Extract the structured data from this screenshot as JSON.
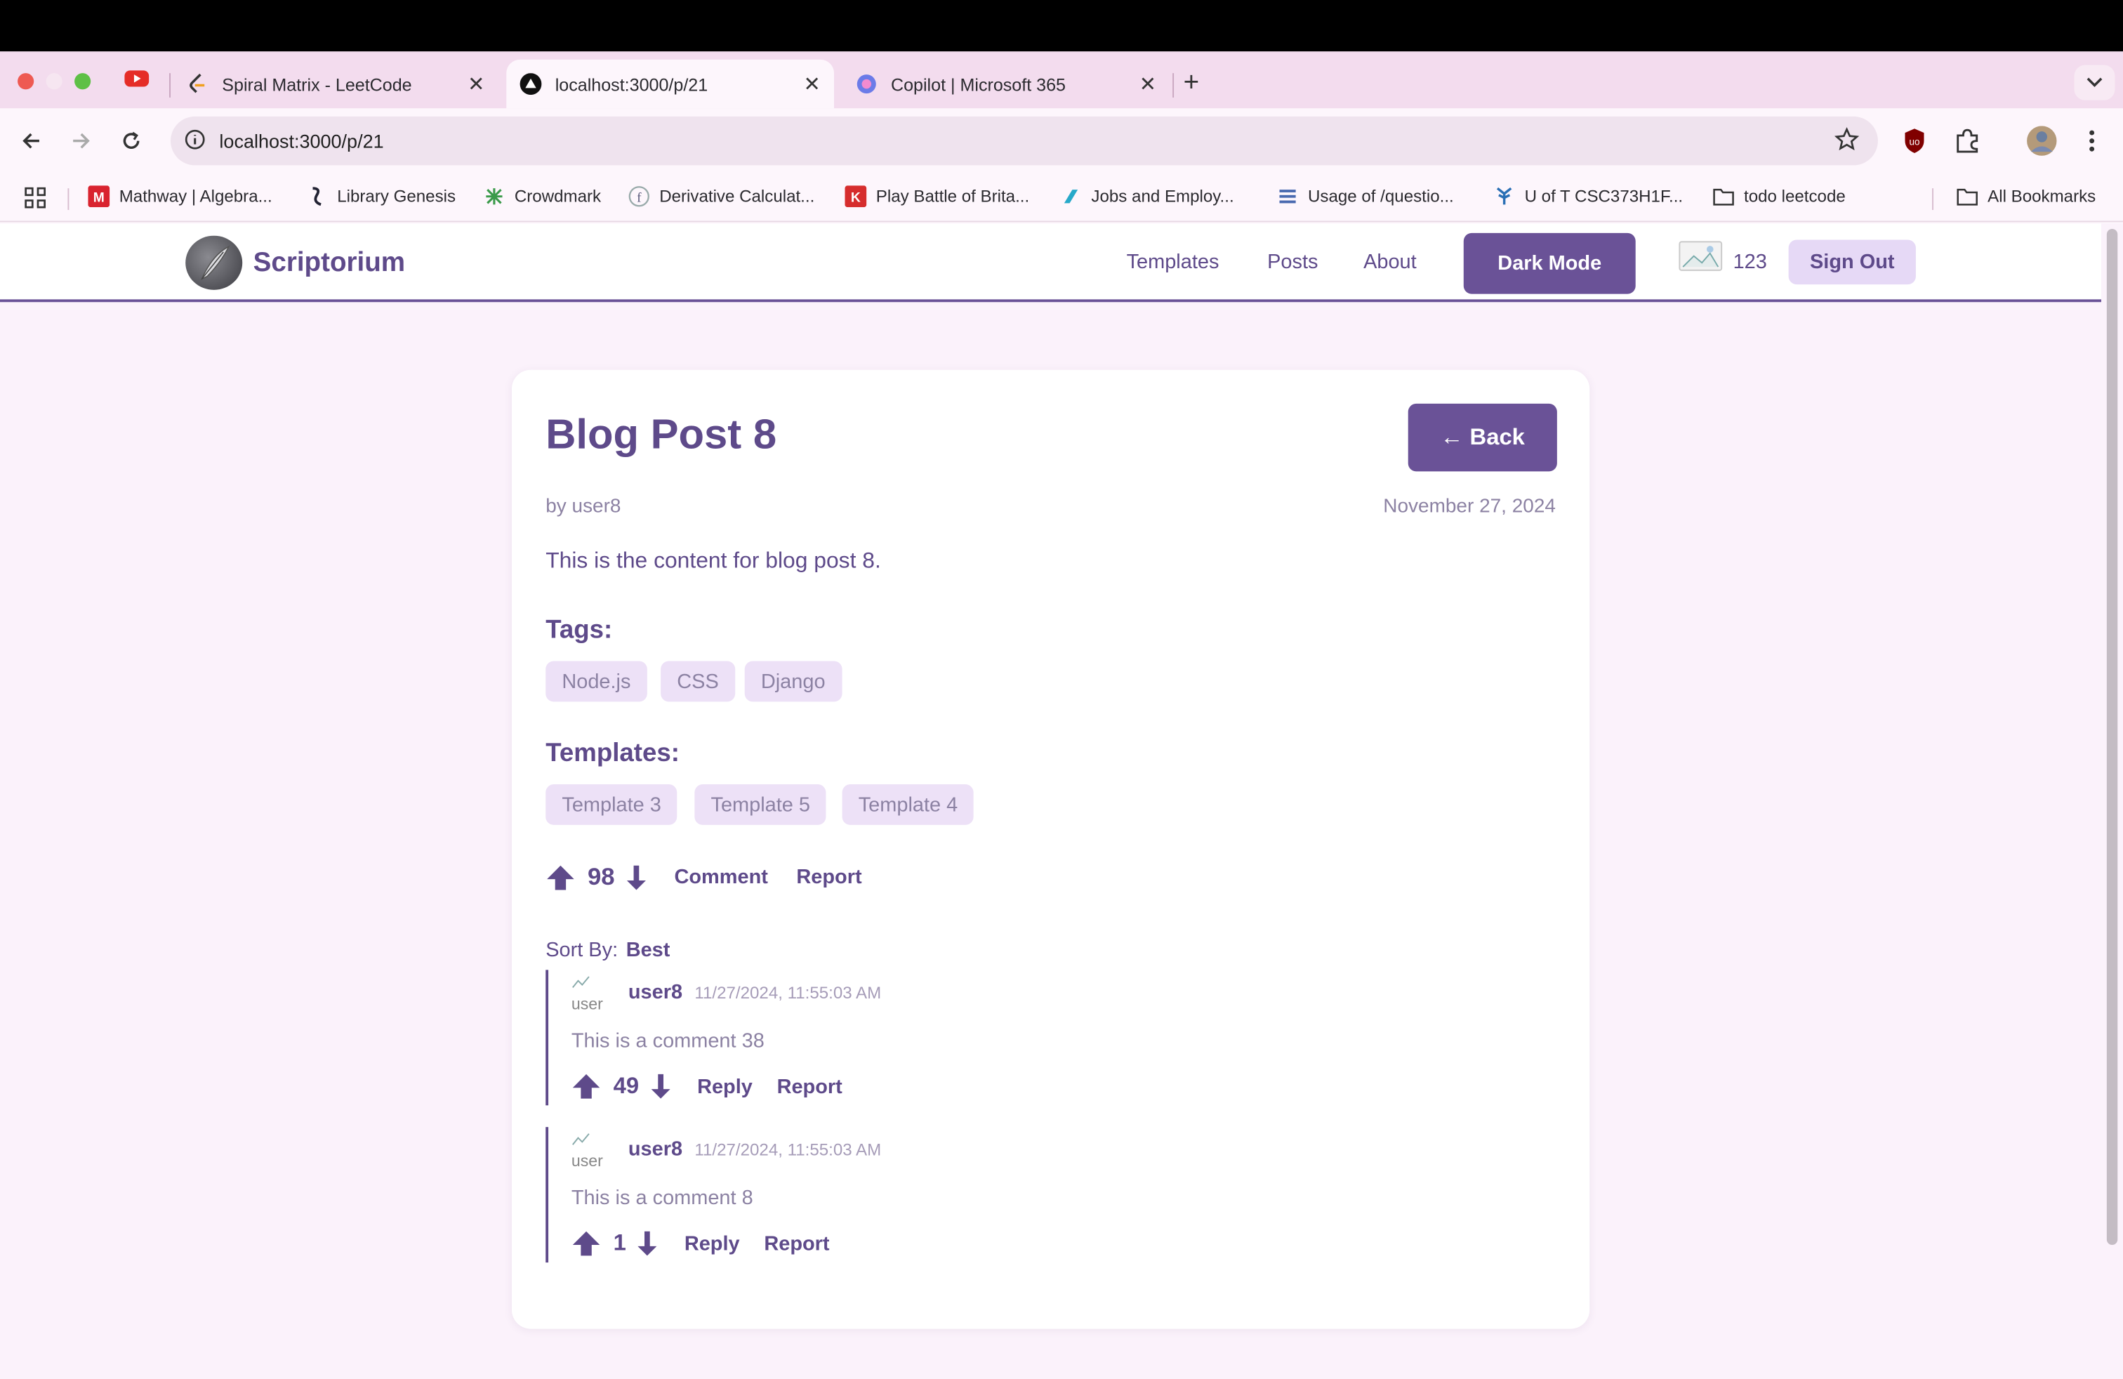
{
  "browser": {
    "tabs": [
      {
        "title": "Spiral Matrix - LeetCode",
        "icon": "leetcode-icon",
        "active": false
      },
      {
        "title": "localhost:3000/p/21",
        "icon": "vercel-triangle-icon",
        "active": true
      },
      {
        "title": "Copilot | Microsoft 365",
        "icon": "copilot-icon",
        "active": false
      }
    ],
    "url": "localhost:3000/p/21",
    "bookmarks": [
      {
        "label": "Mathway | Algebra...",
        "icon": "mathway-icon"
      },
      {
        "label": "Library Genesis",
        "icon": "libgen-icon"
      },
      {
        "label": "Crowdmark",
        "icon": "crowdmark-icon"
      },
      {
        "label": "Derivative Calculat...",
        "icon": "derivative-icon"
      },
      {
        "label": "Play Battle of Brita...",
        "icon": "game-icon"
      },
      {
        "label": "Jobs and Employ...",
        "icon": "jobs-icon"
      },
      {
        "label": "Usage of /questio...",
        "icon": "stack-icon"
      },
      {
        "label": "U of T CSC373H1F...",
        "icon": "uoft-icon"
      },
      {
        "label": "todo leetcode",
        "icon": "folder-icon"
      }
    ],
    "all_bookmarks": "All Bookmarks"
  },
  "site": {
    "brand": "Scriptorium",
    "nav": {
      "templates": "Templates",
      "posts": "Posts",
      "about": "About"
    },
    "dark_mode": "Dark Mode",
    "points": "123",
    "sign_out": "Sign Out"
  },
  "post": {
    "title": "Blog Post 8",
    "back": "← Back",
    "byline": "by user8",
    "date": "November 27, 2024",
    "content": "This is the content for blog post 8.",
    "tags_heading": "Tags:",
    "tags": [
      "Node.js",
      "CSS",
      "Django"
    ],
    "templates_heading": "Templates:",
    "templates": [
      "Template 3",
      "Template 5",
      "Template 4"
    ],
    "score": "98",
    "comment": "Comment",
    "report": "Report"
  },
  "comments_section": {
    "sort_label": "Sort By:",
    "sort_value": "Best",
    "comments": [
      {
        "user": "user8",
        "time": "11/27/2024, 11:55:03 AM",
        "text": "This is a comment 38",
        "score": "49",
        "reply": "Reply",
        "report": "Report",
        "avatar_alt": "user"
      },
      {
        "user": "user8",
        "time": "11/27/2024, 11:55:03 AM",
        "text": "This is a comment 8",
        "score": "1",
        "reply": "Reply",
        "report": "Report",
        "avatar_alt": "user"
      }
    ]
  },
  "colors": {
    "accent": "#6a5297",
    "text": "#5e4a8a",
    "muted": "#8c82a3",
    "chip_bg": "#ede1f7"
  }
}
